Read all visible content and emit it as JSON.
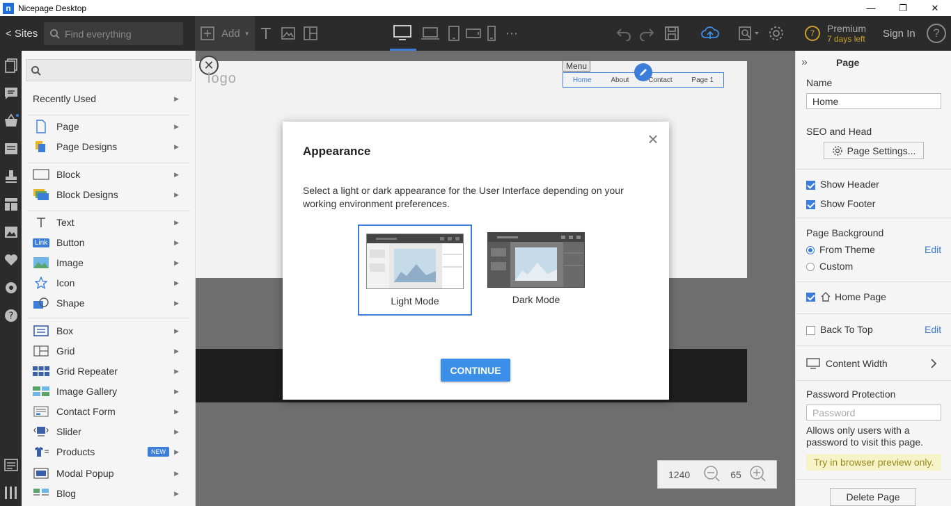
{
  "titlebar": {
    "app_title": "Nicepage Desktop",
    "app_logo": "n",
    "minimize": "—",
    "restore": "❐",
    "close": "✕"
  },
  "toolbar": {
    "sites_label": "< Sites",
    "search_placeholder": "Find everything",
    "add_label": "Add",
    "premium_title": "Premium",
    "premium_sub": "7 days left",
    "premium_badge": "7",
    "signin_label": "Sign In",
    "help_label": "?"
  },
  "add_panel": {
    "sections": [
      [
        "Recently Used"
      ],
      [
        "Page",
        "Page Designs"
      ],
      [
        "Block",
        "Block Designs"
      ],
      [
        "Text",
        "Button",
        "Image",
        "Icon",
        "Shape"
      ],
      [
        "Box",
        "Grid",
        "Grid Repeater",
        "Image Gallery",
        "Contact Form",
        "Slider",
        "Products",
        "Modal Popup",
        "Blog"
      ]
    ],
    "items": {
      "recently_used": "Recently Used",
      "page": "Page",
      "page_designs": "Page Designs",
      "block": "Block",
      "block_designs": "Block Designs",
      "text": "Text",
      "button": "Button",
      "button_icon_text": "Link",
      "image": "Image",
      "icon": "Icon",
      "shape": "Shape",
      "box": "Box",
      "grid": "Grid",
      "grid_repeater": "Grid Repeater",
      "image_gallery": "Image Gallery",
      "contact_form": "Contact Form",
      "slider": "Slider",
      "products": "Products",
      "products_badge": "NEW",
      "modal_popup": "Modal Popup",
      "blog": "Blog"
    }
  },
  "canvas": {
    "logo_text": "logo",
    "menu_tag": "Menu",
    "menu_items": [
      "Home",
      "About",
      "Contact",
      "Page 1"
    ],
    "close_glyph": "✕"
  },
  "zoom": {
    "width_value": "1240",
    "zoom_value": "65"
  },
  "right_panel": {
    "title": "Page",
    "collapse_glyph": "»",
    "name_label": "Name",
    "name_value": "Home",
    "seo_label": "SEO and Head",
    "page_settings_label": "Page Settings...",
    "show_header": "Show Header",
    "show_footer": "Show Footer",
    "page_background_label": "Page Background",
    "from_theme": "From Theme",
    "custom": "Custom",
    "edit_1": "Edit",
    "home_page": "Home Page",
    "back_to_top": "Back To Top",
    "edit_2": "Edit",
    "content_width": "Content Width",
    "password_protection": "Password Protection",
    "password_placeholder": "Password",
    "password_note": "Allows only users with a password to visit this page.",
    "hint": "Try in browser preview only.",
    "delete_page": "Delete Page"
  },
  "modal": {
    "title": "Appearance",
    "description": "Select a light or dark appearance for the User Interface depending on your working environment preferences.",
    "light_label": "Light Mode",
    "dark_label": "Dark Mode",
    "selected": "Light Mode",
    "continue_label": "CONTINUE",
    "close_glyph": "×"
  },
  "colors": {
    "accent": "#3b7dd8",
    "toolbar_bg": "#2b2b2b",
    "continue_bg": "#3b8fe8",
    "premium": "#c9a227"
  }
}
